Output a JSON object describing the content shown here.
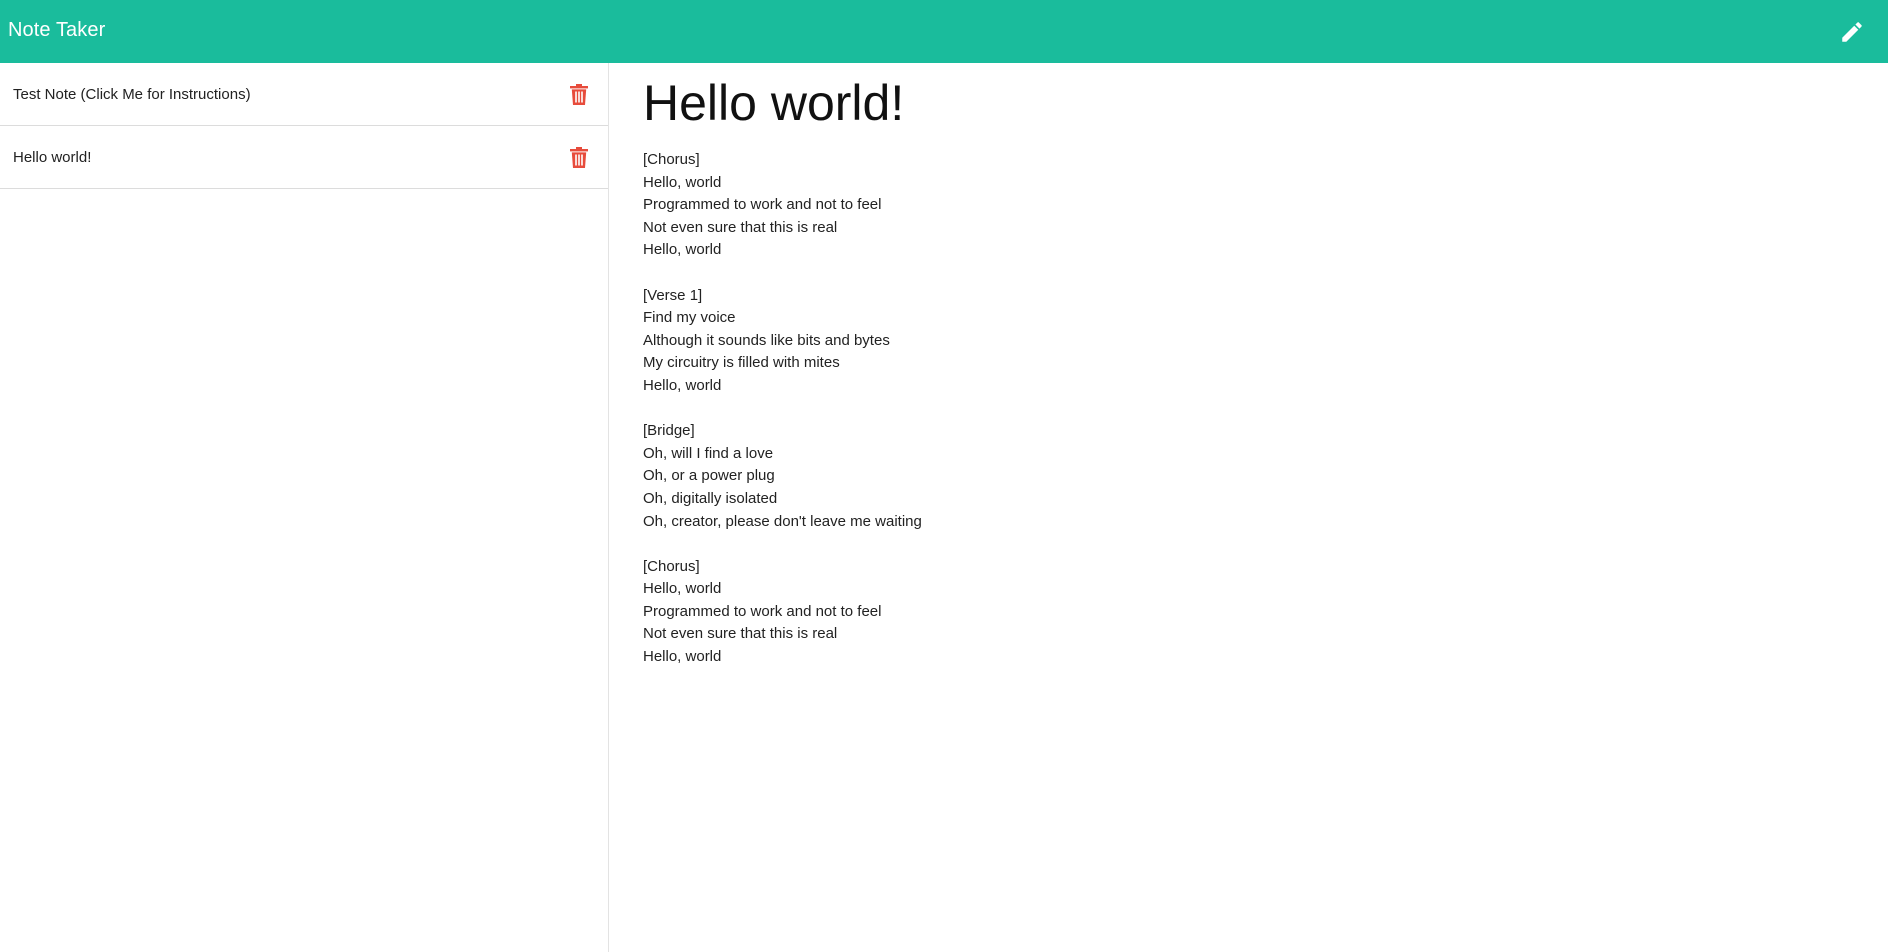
{
  "navbar": {
    "brand": "Note Taker",
    "new_note_icon": "pencil-icon",
    "brand_color": "#1abc9c"
  },
  "sidebar": {
    "notes": [
      {
        "title": "Test Note (Click Me for Instructions)",
        "delete_icon": "trash-icon"
      },
      {
        "title": "Hello world!",
        "delete_icon": "trash-icon"
      }
    ],
    "delete_color": "#e74c3c"
  },
  "main": {
    "title": "Hello world!",
    "body": "[Chorus]\nHello, world\nProgrammed to work and not to feel\nNot even sure that this is real\nHello, world\n\n[Verse 1]\nFind my voice\nAlthough it sounds like bits and bytes\nMy circuitry is filled with mites\nHello, world\n\n[Bridge]\nOh, will I find a love\nOh, or a power plug\nOh, digitally isolated\nOh, creator, please don't leave me waiting\n\n[Chorus]\nHello, world\nProgrammed to work and not to feel\nNot even sure that this is real\nHello, world"
  }
}
